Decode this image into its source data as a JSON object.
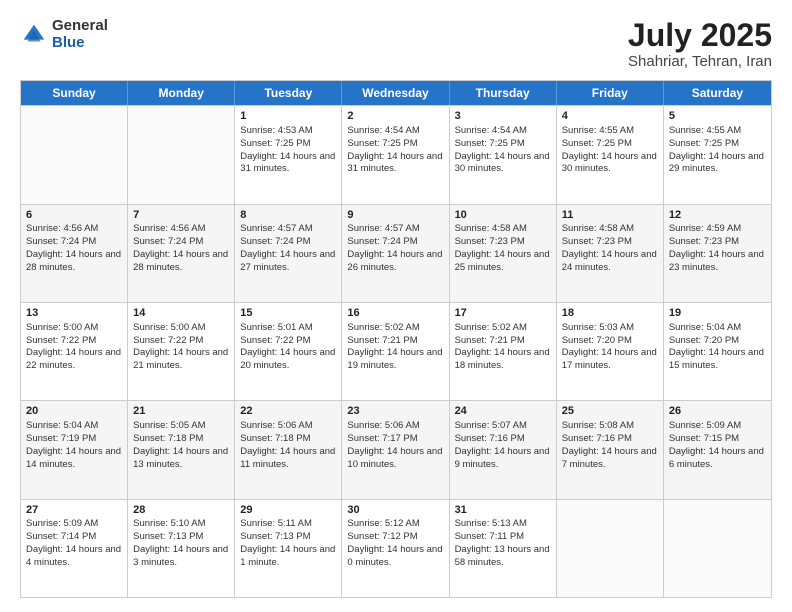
{
  "logo": {
    "general": "General",
    "blue": "Blue"
  },
  "header": {
    "month": "July 2025",
    "location": "Shahriar, Tehran, Iran"
  },
  "weekdays": [
    "Sunday",
    "Monday",
    "Tuesday",
    "Wednesday",
    "Thursday",
    "Friday",
    "Saturday"
  ],
  "rows": [
    [
      {
        "day": "",
        "sunrise": "",
        "sunset": "",
        "daylight": "",
        "empty": true
      },
      {
        "day": "",
        "sunrise": "",
        "sunset": "",
        "daylight": "",
        "empty": true
      },
      {
        "day": "1",
        "sunrise": "Sunrise: 4:53 AM",
        "sunset": "Sunset: 7:25 PM",
        "daylight": "Daylight: 14 hours and 31 minutes."
      },
      {
        "day": "2",
        "sunrise": "Sunrise: 4:54 AM",
        "sunset": "Sunset: 7:25 PM",
        "daylight": "Daylight: 14 hours and 31 minutes."
      },
      {
        "day": "3",
        "sunrise": "Sunrise: 4:54 AM",
        "sunset": "Sunset: 7:25 PM",
        "daylight": "Daylight: 14 hours and 30 minutes."
      },
      {
        "day": "4",
        "sunrise": "Sunrise: 4:55 AM",
        "sunset": "Sunset: 7:25 PM",
        "daylight": "Daylight: 14 hours and 30 minutes."
      },
      {
        "day": "5",
        "sunrise": "Sunrise: 4:55 AM",
        "sunset": "Sunset: 7:25 PM",
        "daylight": "Daylight: 14 hours and 29 minutes."
      }
    ],
    [
      {
        "day": "6",
        "sunrise": "Sunrise: 4:56 AM",
        "sunset": "Sunset: 7:24 PM",
        "daylight": "Daylight: 14 hours and 28 minutes."
      },
      {
        "day": "7",
        "sunrise": "Sunrise: 4:56 AM",
        "sunset": "Sunset: 7:24 PM",
        "daylight": "Daylight: 14 hours and 28 minutes."
      },
      {
        "day": "8",
        "sunrise": "Sunrise: 4:57 AM",
        "sunset": "Sunset: 7:24 PM",
        "daylight": "Daylight: 14 hours and 27 minutes."
      },
      {
        "day": "9",
        "sunrise": "Sunrise: 4:57 AM",
        "sunset": "Sunset: 7:24 PM",
        "daylight": "Daylight: 14 hours and 26 minutes."
      },
      {
        "day": "10",
        "sunrise": "Sunrise: 4:58 AM",
        "sunset": "Sunset: 7:23 PM",
        "daylight": "Daylight: 14 hours and 25 minutes."
      },
      {
        "day": "11",
        "sunrise": "Sunrise: 4:58 AM",
        "sunset": "Sunset: 7:23 PM",
        "daylight": "Daylight: 14 hours and 24 minutes."
      },
      {
        "day": "12",
        "sunrise": "Sunrise: 4:59 AM",
        "sunset": "Sunset: 7:23 PM",
        "daylight": "Daylight: 14 hours and 23 minutes."
      }
    ],
    [
      {
        "day": "13",
        "sunrise": "Sunrise: 5:00 AM",
        "sunset": "Sunset: 7:22 PM",
        "daylight": "Daylight: 14 hours and 22 minutes."
      },
      {
        "day": "14",
        "sunrise": "Sunrise: 5:00 AM",
        "sunset": "Sunset: 7:22 PM",
        "daylight": "Daylight: 14 hours and 21 minutes."
      },
      {
        "day": "15",
        "sunrise": "Sunrise: 5:01 AM",
        "sunset": "Sunset: 7:22 PM",
        "daylight": "Daylight: 14 hours and 20 minutes."
      },
      {
        "day": "16",
        "sunrise": "Sunrise: 5:02 AM",
        "sunset": "Sunset: 7:21 PM",
        "daylight": "Daylight: 14 hours and 19 minutes."
      },
      {
        "day": "17",
        "sunrise": "Sunrise: 5:02 AM",
        "sunset": "Sunset: 7:21 PM",
        "daylight": "Daylight: 14 hours and 18 minutes."
      },
      {
        "day": "18",
        "sunrise": "Sunrise: 5:03 AM",
        "sunset": "Sunset: 7:20 PM",
        "daylight": "Daylight: 14 hours and 17 minutes."
      },
      {
        "day": "19",
        "sunrise": "Sunrise: 5:04 AM",
        "sunset": "Sunset: 7:20 PM",
        "daylight": "Daylight: 14 hours and 15 minutes."
      }
    ],
    [
      {
        "day": "20",
        "sunrise": "Sunrise: 5:04 AM",
        "sunset": "Sunset: 7:19 PM",
        "daylight": "Daylight: 14 hours and 14 minutes."
      },
      {
        "day": "21",
        "sunrise": "Sunrise: 5:05 AM",
        "sunset": "Sunset: 7:18 PM",
        "daylight": "Daylight: 14 hours and 13 minutes."
      },
      {
        "day": "22",
        "sunrise": "Sunrise: 5:06 AM",
        "sunset": "Sunset: 7:18 PM",
        "daylight": "Daylight: 14 hours and 11 minutes."
      },
      {
        "day": "23",
        "sunrise": "Sunrise: 5:06 AM",
        "sunset": "Sunset: 7:17 PM",
        "daylight": "Daylight: 14 hours and 10 minutes."
      },
      {
        "day": "24",
        "sunrise": "Sunrise: 5:07 AM",
        "sunset": "Sunset: 7:16 PM",
        "daylight": "Daylight: 14 hours and 9 minutes."
      },
      {
        "day": "25",
        "sunrise": "Sunrise: 5:08 AM",
        "sunset": "Sunset: 7:16 PM",
        "daylight": "Daylight: 14 hours and 7 minutes."
      },
      {
        "day": "26",
        "sunrise": "Sunrise: 5:09 AM",
        "sunset": "Sunset: 7:15 PM",
        "daylight": "Daylight: 14 hours and 6 minutes."
      }
    ],
    [
      {
        "day": "27",
        "sunrise": "Sunrise: 5:09 AM",
        "sunset": "Sunset: 7:14 PM",
        "daylight": "Daylight: 14 hours and 4 minutes."
      },
      {
        "day": "28",
        "sunrise": "Sunrise: 5:10 AM",
        "sunset": "Sunset: 7:13 PM",
        "daylight": "Daylight: 14 hours and 3 minutes."
      },
      {
        "day": "29",
        "sunrise": "Sunrise: 5:11 AM",
        "sunset": "Sunset: 7:13 PM",
        "daylight": "Daylight: 14 hours and 1 minute."
      },
      {
        "day": "30",
        "sunrise": "Sunrise: 5:12 AM",
        "sunset": "Sunset: 7:12 PM",
        "daylight": "Daylight: 14 hours and 0 minutes."
      },
      {
        "day": "31",
        "sunrise": "Sunrise: 5:13 AM",
        "sunset": "Sunset: 7:11 PM",
        "daylight": "Daylight: 13 hours and 58 minutes."
      },
      {
        "day": "",
        "sunrise": "",
        "sunset": "",
        "daylight": "",
        "empty": true
      },
      {
        "day": "",
        "sunrise": "",
        "sunset": "",
        "daylight": "",
        "empty": true
      }
    ]
  ]
}
